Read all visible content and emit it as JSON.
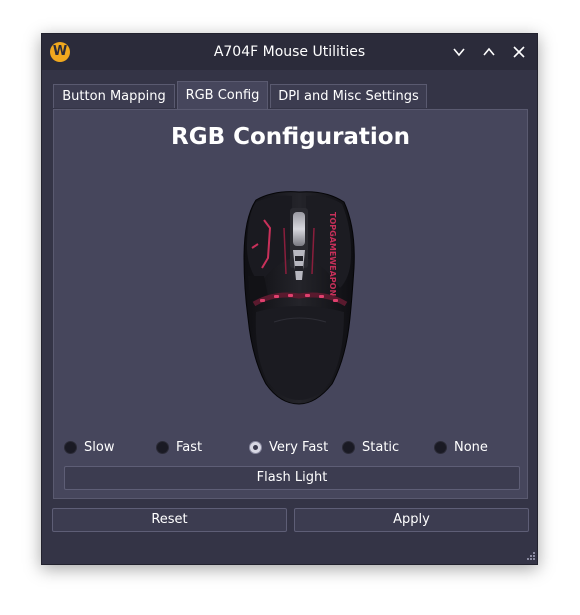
{
  "window": {
    "title": "A704F Mouse Utilities",
    "app_icon_letter": "W"
  },
  "tabs": [
    {
      "label": "Button Mapping",
      "active": false
    },
    {
      "label": "RGB Config",
      "active": true
    },
    {
      "label": "DPI and Misc Settings",
      "active": false
    }
  ],
  "panel": {
    "heading": "RGB Configuration",
    "mouse_brand_text": "TOPGAMEWEAPON",
    "speed_options": [
      {
        "label": "Slow",
        "checked": false
      },
      {
        "label": "Fast",
        "checked": false
      },
      {
        "label": "Very Fast",
        "checked": true
      },
      {
        "label": "Static",
        "checked": false
      },
      {
        "label": "None",
        "checked": false
      }
    ],
    "flash_button_label": "Flash Light"
  },
  "footer": {
    "reset_label": "Reset",
    "apply_label": "Apply"
  },
  "colors": {
    "window_bg": "#343446",
    "panel_bg": "#46465c",
    "app_icon": "#f0a81e",
    "mouse_led": "#c8305a"
  }
}
